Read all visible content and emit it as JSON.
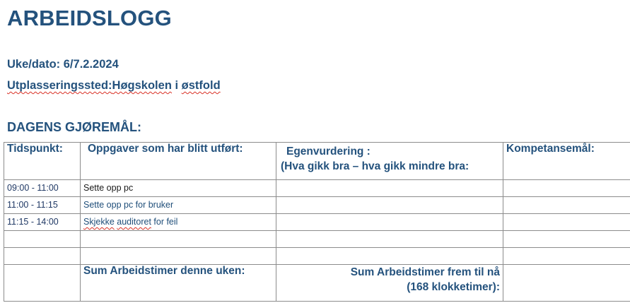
{
  "document": {
    "title": "ARBEIDSLOGG",
    "week_label": "Uke/dato: 6/7.2.2024",
    "place_label": "Utplasseringssted:",
    "place_value": "Høgskolen",
    "place_i": " i ",
    "place_county": "østfold",
    "section_title": "DAGENS GJØREMÅL:"
  },
  "table": {
    "headers": {
      "time": "Tidspunkt:",
      "tasks": "Oppgaver som har blitt utført:",
      "self_eval_line1": "Egenvurdering :",
      "self_eval_line2": "(Hva gikk bra – hva gikk mindre bra:",
      "competence": "Kompetansemål:"
    },
    "rows": [
      {
        "time": "09:00 - 11:00",
        "task": "Sette opp pc",
        "eval": "",
        "goal": ""
      },
      {
        "time": "11:00 - 11:15",
        "task": "Sette opp pc for bruker",
        "eval": "",
        "goal": ""
      },
      {
        "time": "11:15 - 14:00",
        "task_word1": "Skjekke",
        "task_word2": "auditoret",
        "task_rest": " for feil",
        "eval": "",
        "goal": ""
      },
      {
        "time": "",
        "task": "",
        "eval": "",
        "goal": ""
      },
      {
        "time": "",
        "task": "",
        "eval": "",
        "goal": ""
      }
    ],
    "summary": {
      "week_hours": "Sum Arbeidstimer denne uken:",
      "total_hours_line1": "Sum Arbeidstimer frem til nå",
      "total_hours_line2": "(168 klokketimer):"
    }
  }
}
